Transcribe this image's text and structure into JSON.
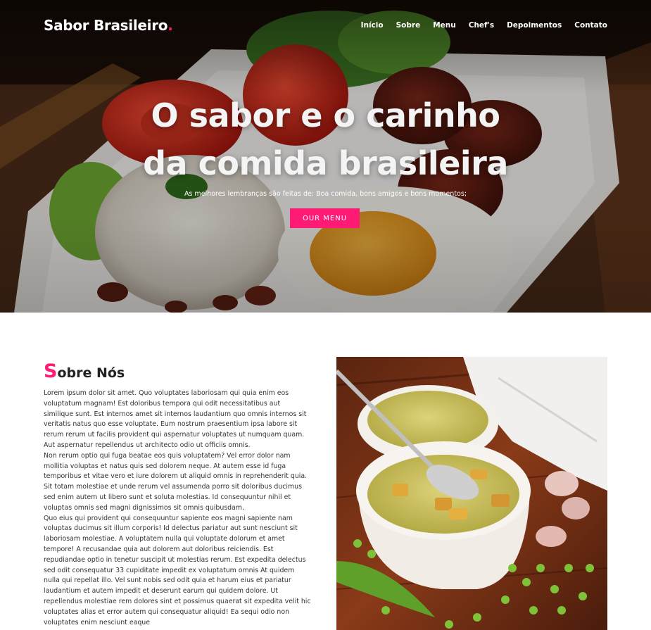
{
  "brand": {
    "name": "Sabor Brasileiro",
    "dot": ".",
    "accent": "#ff1a75"
  },
  "nav": {
    "items": [
      {
        "label": "Início"
      },
      {
        "label": "Sobre"
      },
      {
        "label": "Menu"
      },
      {
        "label": "Chef's"
      },
      {
        "label": "Depoimentos"
      },
      {
        "label": "Contato"
      }
    ]
  },
  "hero": {
    "title_line1": "O sabor e o carinho",
    "title_line2": "da comida brasileira",
    "subtitle": "As melhores lembranças são feitas de: Boa comida, bons amigos e bons momentos;",
    "button_label": "OUR MENU"
  },
  "about": {
    "title_first_letter": "S",
    "title_rest": "obre Nós",
    "paragraphs": [
      "Lorem ipsum dolor sit amet. Quo voluptates laboriosam qui quia enim eos voluptatum magnam! Est doloribus tempora qui odit necessitatibus aut similique sunt. Est internos amet sit internos laudantium quo omnis internos sit veritatis natus quo esse voluptate. Eum nostrum praesentium ipsa labore sit rerum rerum ut facilis provident qui aspernatur voluptates ut numquam quam. Aut aspernatur repellendus ut architecto odio ut officiis omnis.",
      "Non rerum optio qui fuga beatae eos quis voluptatem? Vel error dolor nam mollitia voluptas et natus quis sed dolorem neque. At autem esse id fuga temporibus et vitae vero et iure dolorem ut aliquid omnis in reprehenderit quia. Sit totam molestiae et unde rerum vel assumenda porro sit doloribus ducimus sed enim autem ut libero sunt et soluta molestias. Id consequuntur nihil et voluptas omnis sed magni dignissimos sit omnis quibusdam.",
      "Quo eius qui provident qui consequuntur sapiente eos magni sapiente nam voluptas ducimus sit illum corporis! Id delectus pariatur aut sunt nesciunt sit laboriosam molestiae. A voluptatem nulla qui voluptate dolorum et amet tempore! A recusandae quia aut dolorem aut doloribus reiciendis. Est repudiandae optio in tenetur suscipit ut molestias rerum. Est expedita delectus sed odit consequatur 33 cupiditate impedit ex voluptatum omnis At quidem nulla qui repellat illo. Vel sunt nobis sed odit quia et harum eius et pariatur laudantium et autem impedit et deserunt earum qui quidem dolore. Ut repellendus molestiae rem dolores sint et possimus quaerat sit expedita velit hic voluptates alias et error autem qui consequatur aliquid! Ea sequi odio non voluptates enim nesciunt eaque"
    ]
  },
  "icons": {
    "hero_image": "brazilian-plate-photo",
    "about_image": "pea-soup-photo"
  }
}
